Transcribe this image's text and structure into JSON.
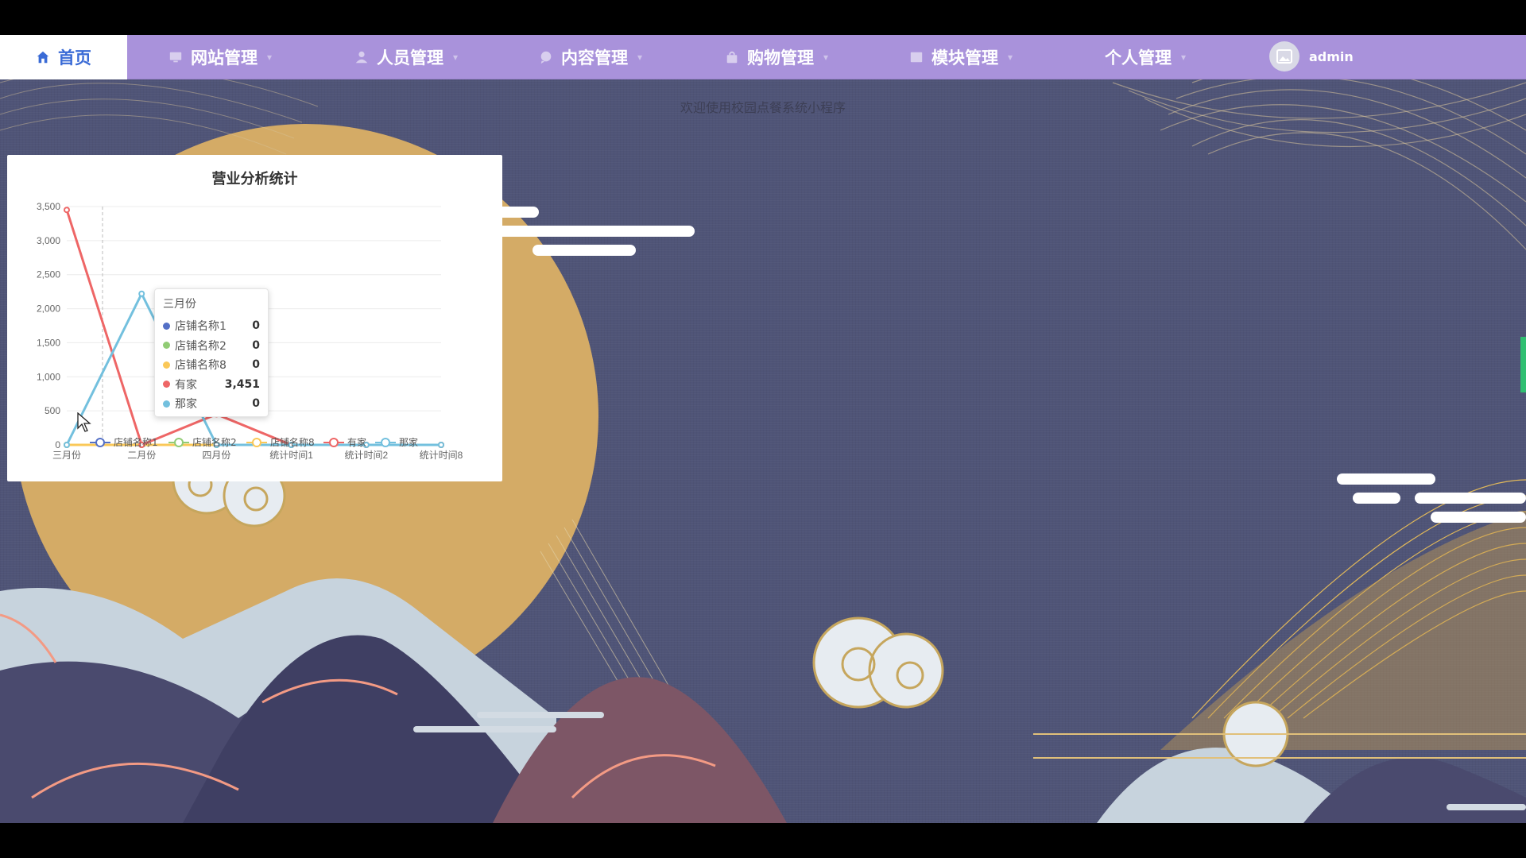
{
  "nav": {
    "home": "首页",
    "items": [
      {
        "label": "网站管理"
      },
      {
        "label": "人员管理"
      },
      {
        "label": "内容管理"
      },
      {
        "label": "购物管理"
      },
      {
        "label": "模块管理"
      },
      {
        "label": "个人管理"
      }
    ],
    "user": "admin"
  },
  "welcome": "欢迎使用校园点餐系统小程序",
  "chart_data": {
    "type": "line",
    "title": "营业分析统计",
    "categories": [
      "三月份",
      "二月份",
      "四月份",
      "统计时间1",
      "统计时间2",
      "统计时间8"
    ],
    "ylim": [
      0,
      3500
    ],
    "yticks": [
      "0",
      "500",
      "1,000",
      "1,500",
      "2,000",
      "2,500",
      "3,000",
      "3,500"
    ],
    "grid": true,
    "legend_position": "bottom",
    "series": [
      {
        "name": "店铺名称1",
        "color": "#5470c6",
        "values": [
          0,
          0,
          0,
          0,
          0,
          0
        ]
      },
      {
        "name": "店铺名称2",
        "color": "#91cc75",
        "values": [
          0,
          0,
          0,
          0,
          0,
          0
        ]
      },
      {
        "name": "店铺名称8",
        "color": "#fac858",
        "values": [
          0,
          0,
          0,
          0,
          0,
          0
        ]
      },
      {
        "name": "有家",
        "color": "#ee6666",
        "values": [
          3451,
          0,
          450,
          0,
          0,
          0
        ]
      },
      {
        "name": "那家",
        "color": "#73c0de",
        "values": [
          0,
          2220,
          0,
          0,
          0,
          0
        ]
      }
    ],
    "tooltip": {
      "title": "三月份",
      "rows": [
        {
          "name": "店铺名称1",
          "value": "0",
          "color": "#5470c6"
        },
        {
          "name": "店铺名称2",
          "value": "0",
          "color": "#91cc75"
        },
        {
          "name": "店铺名称8",
          "value": "0",
          "color": "#fac858"
        },
        {
          "name": "有家",
          "value": "3,451",
          "color": "#ee6666"
        },
        {
          "name": "那家",
          "value": "0",
          "color": "#73c0de"
        }
      ]
    }
  }
}
